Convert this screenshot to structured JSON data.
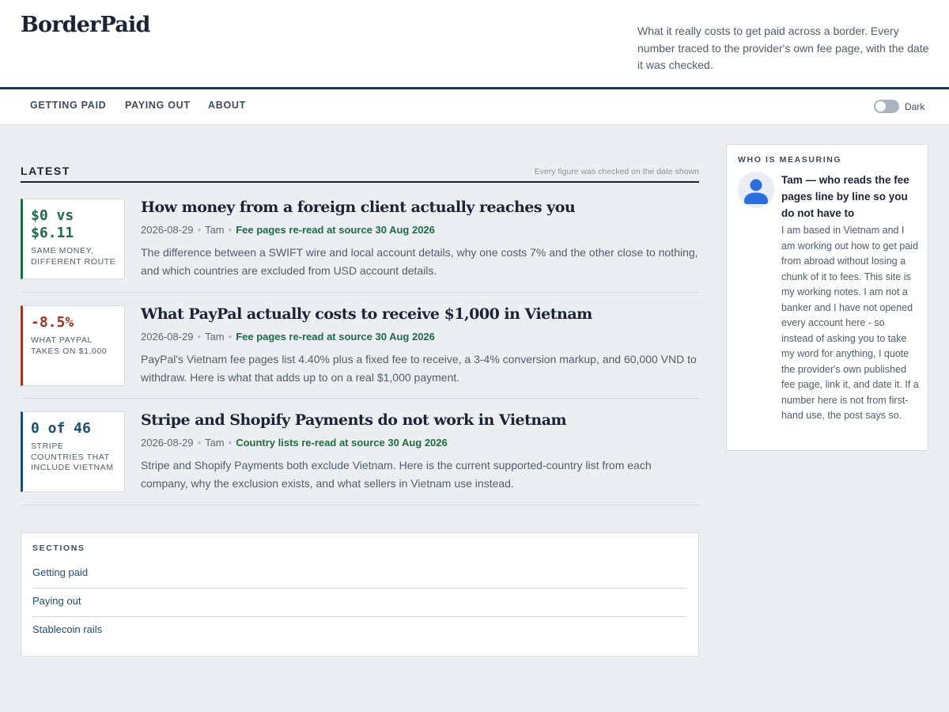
{
  "site": {
    "name": "BorderPaid",
    "tagline": "What it really costs to get paid across a border. Every number traced to the provider's own fee page, with the date it was checked."
  },
  "nav": {
    "items": [
      "GETTING PAID",
      "PAYING OUT",
      "ABOUT"
    ],
    "theme_toggle": {
      "label": "Dark",
      "state": "off"
    }
  },
  "latest": {
    "heading": "LATEST",
    "note": "Every figure was checked on the date shown",
    "posts": [
      {
        "stat": "$0 vs $6.11",
        "stat_caption": "SAME MONEY, DIFFERENT ROUTE",
        "stat_color": "#1e6b46",
        "title": "How money from a foreign client actually reaches you",
        "date": "2026-08-29",
        "author": "Tam",
        "verified": "Fee pages re-read at source 30 Aug 2026",
        "excerpt": "The difference between a SWIFT wire and local account details, why one costs 7% and the other close to nothing, and which countries are excluded from USD account details."
      },
      {
        "stat": "-8.5%",
        "stat_caption": "WHAT PAYPAL TAKES ON $1,000",
        "stat_color": "#a03226",
        "title": "What PayPal actually costs to receive $1,000 in Vietnam",
        "date": "2026-08-29",
        "author": "Tam",
        "verified": "Fee pages re-read at source 30 Aug 2026",
        "excerpt": "PayPal's Vietnam fee pages list 4.40% plus a fixed fee to receive, a 3-4% conversion markup, and 60,000 VND to withdraw. Here is what that adds up to on a real $1,000 payment."
      },
      {
        "stat": "0 of 46",
        "stat_caption": "STRIPE COUNTRIES THAT INCLUDE VIETNAM",
        "stat_color": "#1d4e7a",
        "title": "Stripe and Shopify Payments do not work in Vietnam",
        "date": "2026-08-29",
        "author": "Tam",
        "verified": "Country lists re-read at source 30 Aug 2026",
        "excerpt": "Stripe and Shopify Payments both exclude Vietnam. Here is the current supported-country list from each company, why the exclusion exists, and what sellers in Vietnam use instead."
      }
    ]
  },
  "sections": {
    "title": "SECTIONS",
    "links": [
      "Getting paid",
      "Paying out",
      "Stablecoin rails"
    ]
  },
  "sidebar": {
    "title": "WHO IS MEASURING",
    "avatar_icon": "user-icon",
    "author_heading": "Tam — who reads the fee pages line by line so you do not have to",
    "bio": "I am based in Vietnam and I am working out how to get paid from abroad without losing a chunk of it to fees. This site is my working notes. I am not a banker and I have not opened every account here - so instead of asking you to take my word for anything, I quote the provider's own published fee page, link it, and date it. If a number here is not from first-hand use, the post says so."
  },
  "colors": {
    "accent_navy": "#183a5a",
    "positive_green": "#1e6b46",
    "negative_red": "#a03226",
    "link_blue": "#1d4e7a",
    "page_background": "#eceff2"
  }
}
